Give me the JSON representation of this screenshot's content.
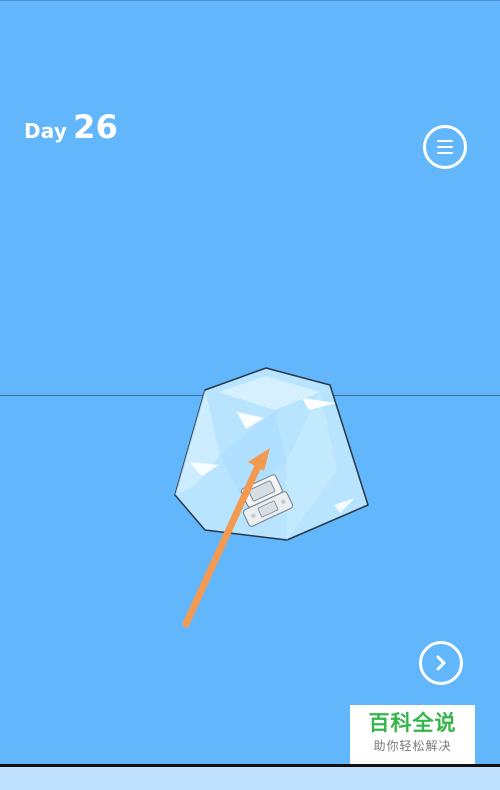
{
  "game": {
    "day_label": "Day",
    "day_number": "26"
  },
  "controls": {
    "menu_icon": "hamburger-menu-icon",
    "next_icon": "chevron-right-icon"
  },
  "scene": {
    "ice_block": "ice-cube",
    "frozen_item": "handheld-game-console",
    "hint_arrow": "orange-up-right-arrow"
  },
  "watermark": {
    "title": "百科全说",
    "subtitle": "助你轻松解决"
  },
  "colors": {
    "sky_blue": "#62b6fb",
    "ice_blue": "#b8e4ff",
    "arrow_orange": "#f39a52",
    "watermark_green": "#35b64a"
  }
}
